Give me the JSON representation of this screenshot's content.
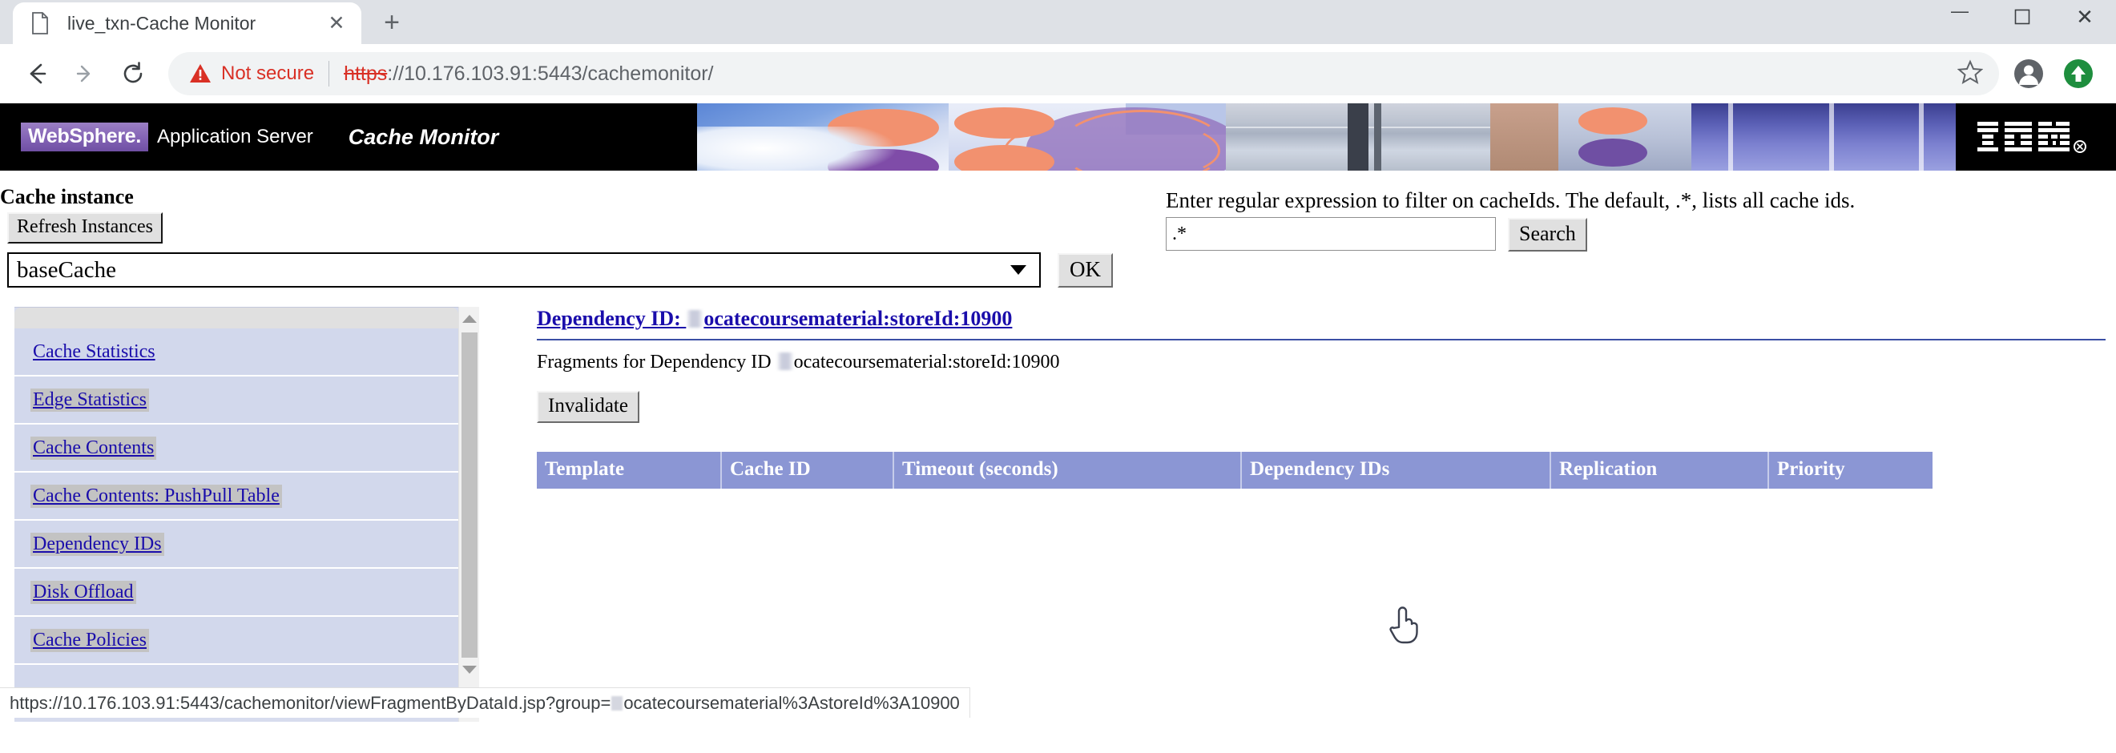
{
  "browser": {
    "tab": {
      "title": "live_txn-Cache Monitor",
      "favicon_name": "document-icon",
      "close_label": "✕"
    },
    "new_tab_label": "+",
    "window_controls": {
      "minimize": "—",
      "maximize": "❐",
      "close": "✕"
    },
    "nav": {
      "back": "←",
      "forward": "→",
      "reload": "⟳"
    },
    "omnibox": {
      "security_label": "Not secure",
      "warning_icon": "warning-triangle-icon",
      "url_scheme": "https",
      "url_rest": "://10.176.103.91:5443/cachemonitor/",
      "url_full": "https://10.176.103.91:5443/cachemonitor/",
      "bookmark_icon": "star-icon"
    },
    "profile_icon": "account-avatar-icon",
    "update_icon": "update-arrow-icon"
  },
  "banner": {
    "logo_text": "WebSphere.",
    "product": "Application Server",
    "app_title": "Cache Monitor",
    "ibm_logo": "IBM",
    "ibm_trademark": "®"
  },
  "cache_instance": {
    "label": "Cache instance",
    "refresh_button": "Refresh Instances",
    "selected": "baseCache",
    "options": [
      "baseCache"
    ],
    "ok_button": "OK"
  },
  "filter": {
    "description": "Enter regular expression to filter on cacheIds. The default, .*, lists all cache ids.",
    "value": ".*",
    "placeholder": "",
    "search_button": "Search"
  },
  "sidebar": {
    "items": [
      {
        "label": "Cache Statistics",
        "visited": true
      },
      {
        "label": "Edge Statistics",
        "visited": false
      },
      {
        "label": "Cache Contents",
        "visited": false
      },
      {
        "label": "Cache Contents: PushPull Table",
        "visited": false
      },
      {
        "label": "Dependency IDs",
        "visited": false
      },
      {
        "label": "Disk Offload",
        "visited": false
      },
      {
        "label": "Cache Policies",
        "visited": false
      }
    ]
  },
  "main": {
    "dependency_heading_prefix": "Dependency ID: ",
    "dependency_id_value": "ocatecoursematerial:storeId:10900",
    "fragments_prefix": "Fragments for Dependency ID ",
    "fragments_value": "ocatecoursematerial:storeId:10900",
    "invalidate_button": "Invalidate",
    "table": {
      "columns": [
        "Template",
        "Cache ID",
        "Timeout (seconds)",
        "Dependency IDs",
        "Replication",
        "Priority"
      ],
      "rows": []
    }
  },
  "statusbar": {
    "url_prefix": "https://10.176.103.91:5443/cachemonitor/viewFragmentByDataId.jsp?group=",
    "url_suffix": "ocatecoursematerial%3AstoreId%3A10900"
  },
  "cursor": {
    "type": "pointer-hand-cursor"
  },
  "colors": {
    "banner_bg": "#000000",
    "websphere_purple": "#8363b5",
    "table_header": "#8b96d4",
    "link_blue": "#1a0dab",
    "sidebar_bg": "#d2d8ec",
    "not_secure_red": "#d93025"
  }
}
